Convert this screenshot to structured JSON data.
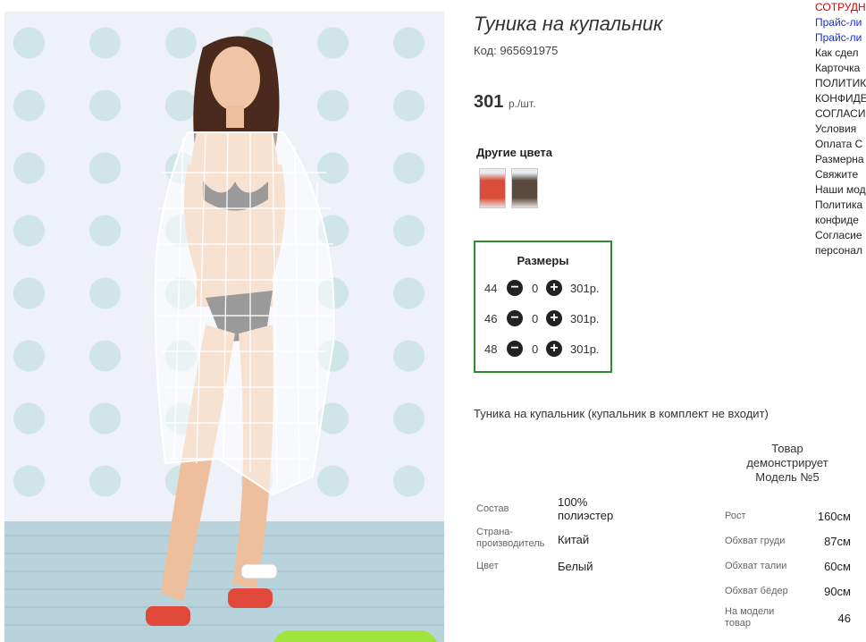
{
  "product": {
    "title": "Туника на купальник",
    "code": "Код: 965691975",
    "price": "301",
    "price_unit": "р./шт.",
    "other_colors_label": "Другие цвета",
    "other_colors": [
      {
        "name": "red-color-thumbnail",
        "color": "#d94d3a"
      },
      {
        "name": "dark-color-thumbnail",
        "color": "#5a4a3c"
      }
    ],
    "description": "Туника на купальник (купальник в комплект не входит)"
  },
  "sizes": {
    "header": "Размеры",
    "rows": [
      {
        "size": "44",
        "qty": "0",
        "price": "301р."
      },
      {
        "size": "46",
        "qty": "0",
        "price": "301р."
      },
      {
        "size": "48",
        "qty": "0",
        "price": "301р."
      }
    ]
  },
  "specs": [
    {
      "label": "Состав",
      "value": "100% полиэстер"
    },
    {
      "label": "Страна-производитель",
      "value": "Китай"
    },
    {
      "label": "Цвет",
      "value": "Белый"
    }
  ],
  "model": {
    "title": "Товар демонстрирует Модель №5",
    "measurements": [
      {
        "label": "Рост",
        "value": "160см"
      },
      {
        "label": "Обхват груди",
        "value": "87см"
      },
      {
        "label": "Обхват талии",
        "value": "60см"
      },
      {
        "label": "Обхват бёдер",
        "value": "90см"
      },
      {
        "label": "На модели товар",
        "value": "46"
      }
    ]
  },
  "sidebar": {
    "links": [
      {
        "text": "СОТРУДН",
        "style": "red"
      },
      {
        "text": "Прайс-ли",
        "style": "blue"
      },
      {
        "text": "Прайс-ли",
        "style": "blue"
      },
      {
        "text": "Как сдел",
        "style": "plain"
      },
      {
        "text": "Карточка",
        "style": "plain"
      },
      {
        "text": "ПОЛИТИК",
        "style": "plain"
      },
      {
        "text": "КОНФИДЕ",
        "style": "plain"
      },
      {
        "text": "СОГЛАСИ",
        "style": "plain"
      },
      {
        "text": "Условия",
        "style": "plain"
      },
      {
        "text": "Оплата С",
        "style": "plain"
      },
      {
        "text": "Размерна",
        "style": "plain"
      },
      {
        "text": "Свяжите",
        "style": "plain"
      },
      {
        "text": "Наши мод",
        "style": "plain"
      },
      {
        "text": "Политика",
        "style": "plain"
      },
      {
        "text": "конфиде",
        "style": "plain"
      },
      {
        "text": "Согласие",
        "style": "plain"
      },
      {
        "text": "персонал",
        "style": "plain"
      }
    ]
  },
  "colors": {
    "sizes_border": "#2e8b2e",
    "link_blue": "#1a2fd0",
    "link_red": "#dd0000"
  }
}
